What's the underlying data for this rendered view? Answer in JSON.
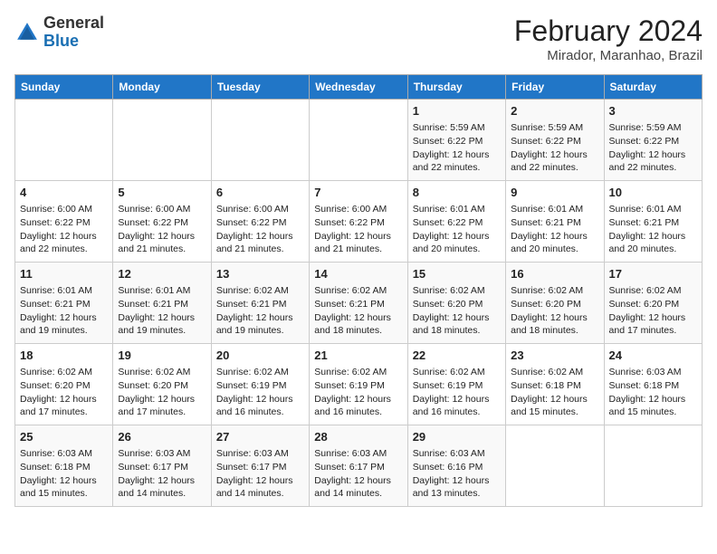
{
  "header": {
    "logo_general": "General",
    "logo_blue": "Blue",
    "month_title": "February 2024",
    "location": "Mirador, Maranhao, Brazil"
  },
  "days_of_week": [
    "Sunday",
    "Monday",
    "Tuesday",
    "Wednesday",
    "Thursday",
    "Friday",
    "Saturday"
  ],
  "weeks": [
    [
      {
        "day": "",
        "info": ""
      },
      {
        "day": "",
        "info": ""
      },
      {
        "day": "",
        "info": ""
      },
      {
        "day": "",
        "info": ""
      },
      {
        "day": "1",
        "info": "Sunrise: 5:59 AM\nSunset: 6:22 PM\nDaylight: 12 hours\nand 22 minutes."
      },
      {
        "day": "2",
        "info": "Sunrise: 5:59 AM\nSunset: 6:22 PM\nDaylight: 12 hours\nand 22 minutes."
      },
      {
        "day": "3",
        "info": "Sunrise: 5:59 AM\nSunset: 6:22 PM\nDaylight: 12 hours\nand 22 minutes."
      }
    ],
    [
      {
        "day": "4",
        "info": "Sunrise: 6:00 AM\nSunset: 6:22 PM\nDaylight: 12 hours\nand 22 minutes."
      },
      {
        "day": "5",
        "info": "Sunrise: 6:00 AM\nSunset: 6:22 PM\nDaylight: 12 hours\nand 21 minutes."
      },
      {
        "day": "6",
        "info": "Sunrise: 6:00 AM\nSunset: 6:22 PM\nDaylight: 12 hours\nand 21 minutes."
      },
      {
        "day": "7",
        "info": "Sunrise: 6:00 AM\nSunset: 6:22 PM\nDaylight: 12 hours\nand 21 minutes."
      },
      {
        "day": "8",
        "info": "Sunrise: 6:01 AM\nSunset: 6:22 PM\nDaylight: 12 hours\nand 20 minutes."
      },
      {
        "day": "9",
        "info": "Sunrise: 6:01 AM\nSunset: 6:21 PM\nDaylight: 12 hours\nand 20 minutes."
      },
      {
        "day": "10",
        "info": "Sunrise: 6:01 AM\nSunset: 6:21 PM\nDaylight: 12 hours\nand 20 minutes."
      }
    ],
    [
      {
        "day": "11",
        "info": "Sunrise: 6:01 AM\nSunset: 6:21 PM\nDaylight: 12 hours\nand 19 minutes."
      },
      {
        "day": "12",
        "info": "Sunrise: 6:01 AM\nSunset: 6:21 PM\nDaylight: 12 hours\nand 19 minutes."
      },
      {
        "day": "13",
        "info": "Sunrise: 6:02 AM\nSunset: 6:21 PM\nDaylight: 12 hours\nand 19 minutes."
      },
      {
        "day": "14",
        "info": "Sunrise: 6:02 AM\nSunset: 6:21 PM\nDaylight: 12 hours\nand 18 minutes."
      },
      {
        "day": "15",
        "info": "Sunrise: 6:02 AM\nSunset: 6:20 PM\nDaylight: 12 hours\nand 18 minutes."
      },
      {
        "day": "16",
        "info": "Sunrise: 6:02 AM\nSunset: 6:20 PM\nDaylight: 12 hours\nand 18 minutes."
      },
      {
        "day": "17",
        "info": "Sunrise: 6:02 AM\nSunset: 6:20 PM\nDaylight: 12 hours\nand 17 minutes."
      }
    ],
    [
      {
        "day": "18",
        "info": "Sunrise: 6:02 AM\nSunset: 6:20 PM\nDaylight: 12 hours\nand 17 minutes."
      },
      {
        "day": "19",
        "info": "Sunrise: 6:02 AM\nSunset: 6:20 PM\nDaylight: 12 hours\nand 17 minutes."
      },
      {
        "day": "20",
        "info": "Sunrise: 6:02 AM\nSunset: 6:19 PM\nDaylight: 12 hours\nand 16 minutes."
      },
      {
        "day": "21",
        "info": "Sunrise: 6:02 AM\nSunset: 6:19 PM\nDaylight: 12 hours\nand 16 minutes."
      },
      {
        "day": "22",
        "info": "Sunrise: 6:02 AM\nSunset: 6:19 PM\nDaylight: 12 hours\nand 16 minutes."
      },
      {
        "day": "23",
        "info": "Sunrise: 6:02 AM\nSunset: 6:18 PM\nDaylight: 12 hours\nand 15 minutes."
      },
      {
        "day": "24",
        "info": "Sunrise: 6:03 AM\nSunset: 6:18 PM\nDaylight: 12 hours\nand 15 minutes."
      }
    ],
    [
      {
        "day": "25",
        "info": "Sunrise: 6:03 AM\nSunset: 6:18 PM\nDaylight: 12 hours\nand 15 minutes."
      },
      {
        "day": "26",
        "info": "Sunrise: 6:03 AM\nSunset: 6:17 PM\nDaylight: 12 hours\nand 14 minutes."
      },
      {
        "day": "27",
        "info": "Sunrise: 6:03 AM\nSunset: 6:17 PM\nDaylight: 12 hours\nand 14 minutes."
      },
      {
        "day": "28",
        "info": "Sunrise: 6:03 AM\nSunset: 6:17 PM\nDaylight: 12 hours\nand 14 minutes."
      },
      {
        "day": "29",
        "info": "Sunrise: 6:03 AM\nSunset: 6:16 PM\nDaylight: 12 hours\nand 13 minutes."
      },
      {
        "day": "",
        "info": ""
      },
      {
        "day": "",
        "info": ""
      }
    ]
  ]
}
